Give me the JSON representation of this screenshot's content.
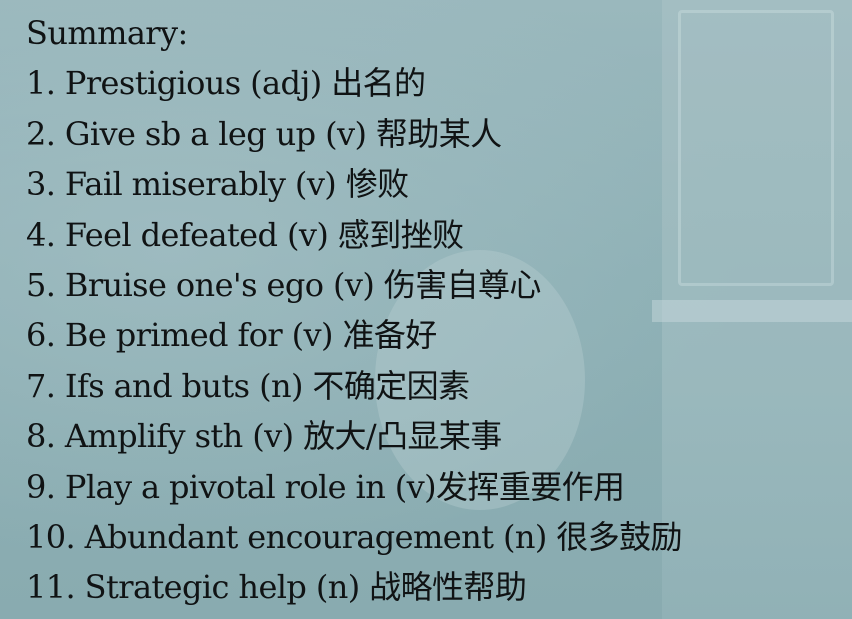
{
  "summary": {
    "heading": "Summary:",
    "items": [
      "1. Prestigious (adj) 出名的",
      "2. Give sb a leg up (v) 帮助某人",
      "3. Fail miserably (v) 惨败",
      "4. Feel defeated (v) 感到挫败",
      "5. Bruise one's ego (v) 伤害自尊心",
      "6. Be primed for (v) 准备好",
      "7. Ifs and buts (n) 不确定因素",
      "8. Amplify sth (v) 放大/凸显某事",
      "9. Play a pivotal role in (v)发挥重要作用",
      "10. Abundant encouragement (n) 很多鼓励",
      "11. Strategic help (n) 战略性帮助"
    ]
  },
  "colors": {
    "background": "#8fb0b6",
    "text": "#101314"
  }
}
